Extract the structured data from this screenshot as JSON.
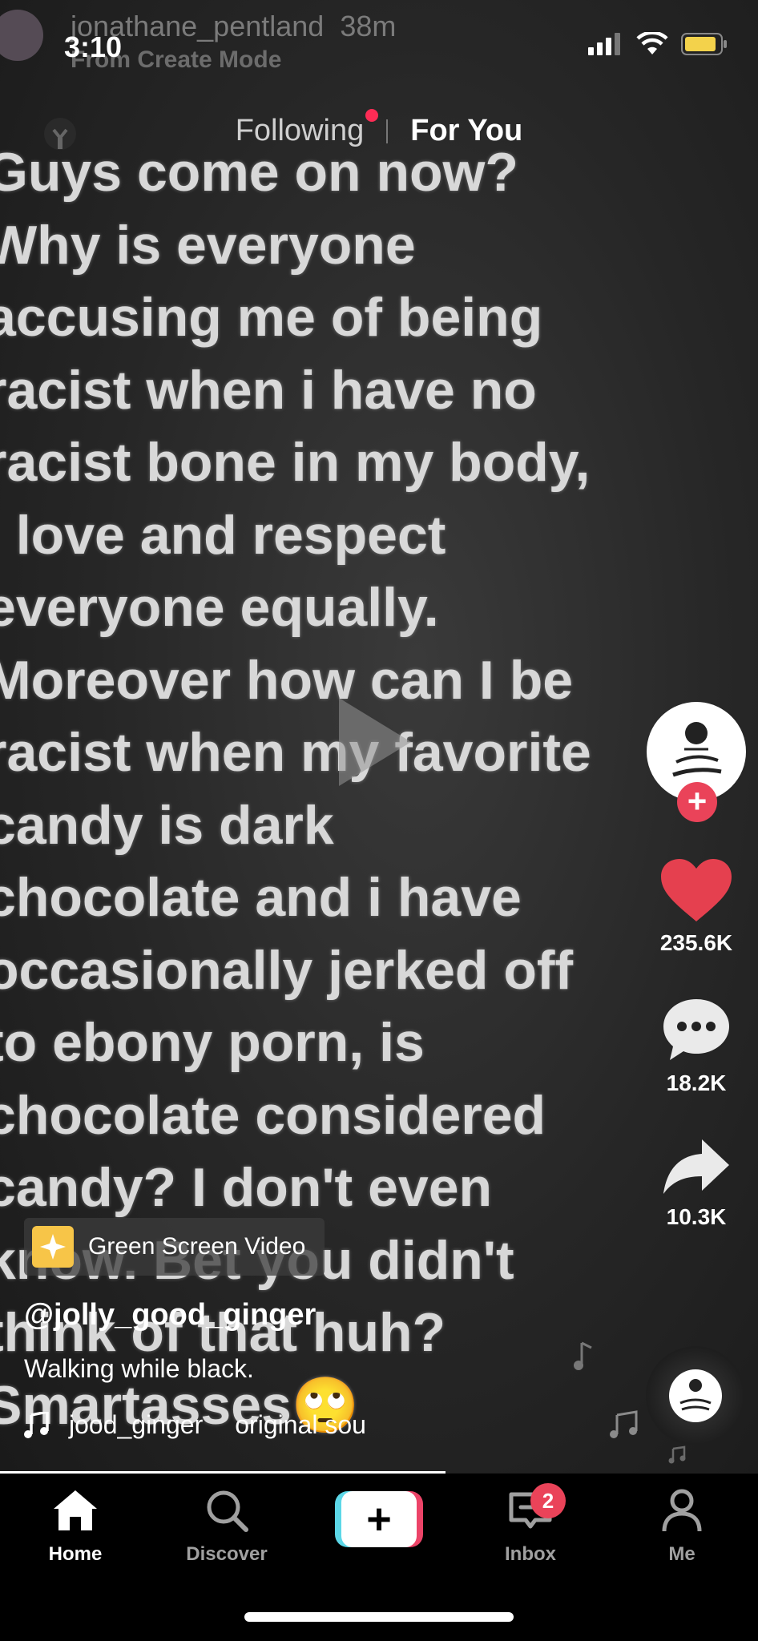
{
  "status_bar": {
    "time": "3:10"
  },
  "ghost_header": {
    "username": "jonathane_pentland",
    "time_ago": "38m",
    "mode": "From Create Mode"
  },
  "feed_tabs": {
    "following": "Following",
    "for_you": "For You"
  },
  "video_text_lines": [
    "Guys come on now?",
    "Why is everyone",
    "accusing me of being",
    "racist when i have no",
    "racist bone in my body,",
    "I love and respect",
    "everyone equally.",
    "Moreover how can I be",
    "racist when my favorite",
    "candy is dark",
    "chocolate and i have",
    "occasionally jerked off",
    "to ebony porn, is",
    "chocolate considered",
    "candy? I don't even",
    "know. Bet you didn't",
    "think of that huh?",
    "Smartasses🙄"
  ],
  "rail": {
    "likes": "235.6K",
    "comments": "18.2K",
    "shares": "10.3K",
    "follow_plus": "+"
  },
  "effect": {
    "label": "Green Screen Video"
  },
  "post": {
    "username": "@jolly_good_ginger",
    "description": "Walking while black.",
    "sound_user": "jood_ginger",
    "sound_title": "original sou"
  },
  "tabbar": {
    "home": "Home",
    "discover": "Discover",
    "create": "+",
    "inbox": "Inbox",
    "inbox_badge": "2",
    "me": "Me"
  },
  "colors": {
    "accent": "#fe2c55",
    "like": "#e5404f",
    "create_cyan": "#5cd7e7",
    "create_pink": "#ec4468"
  }
}
